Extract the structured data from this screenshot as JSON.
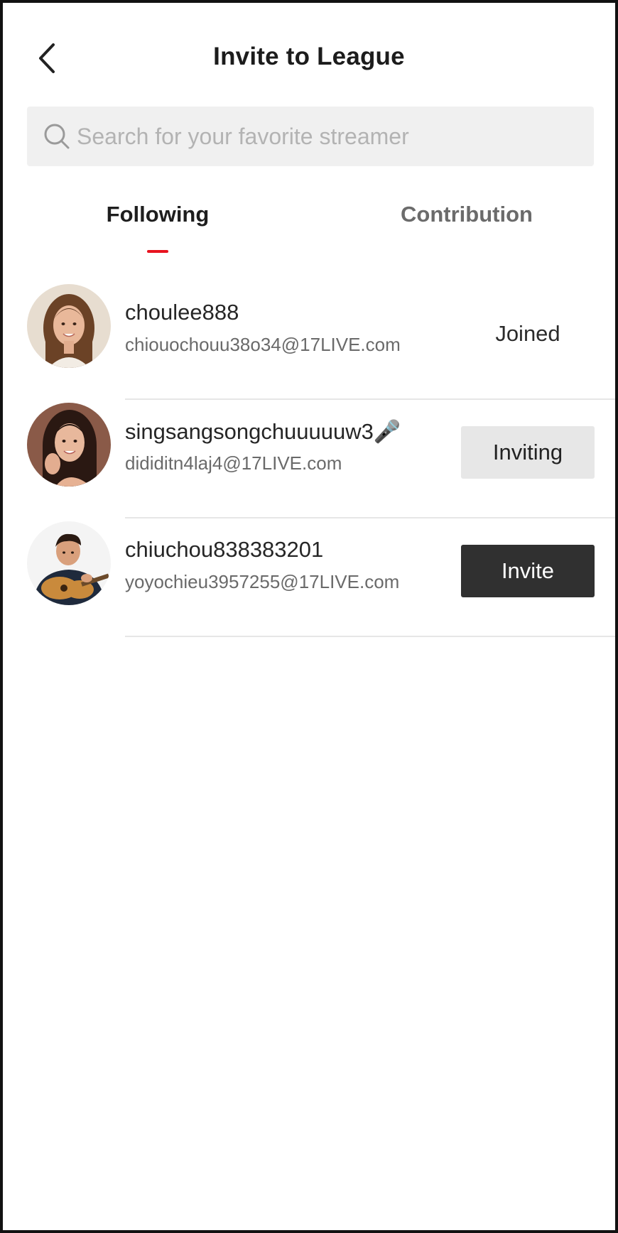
{
  "header": {
    "title": "Invite to League",
    "back_icon": "chevron-left-icon"
  },
  "search": {
    "placeholder": "Search for your favorite streamer",
    "icon": "search-icon"
  },
  "tabs": [
    {
      "label": "Following",
      "active": true
    },
    {
      "label": "Contribution",
      "active": false
    }
  ],
  "colors": {
    "accent": "#e8131f",
    "invite_button": "#303030",
    "inviting_button": "#e7e7e7"
  },
  "streamers": [
    {
      "name": "choulee888",
      "email": "chiouochouu38o34@17LIVE.com",
      "action": "Joined",
      "state": "joined"
    },
    {
      "name": "singsangsongchuuuuuw3🎤",
      "email": "dididitn4laj4@17LIVE.com",
      "action": "Inviting",
      "state": "inviting"
    },
    {
      "name": "chiuchou838383201",
      "email": "yoyochieu3957255@17LIVE.com",
      "action": "Invite",
      "state": "invite"
    }
  ]
}
